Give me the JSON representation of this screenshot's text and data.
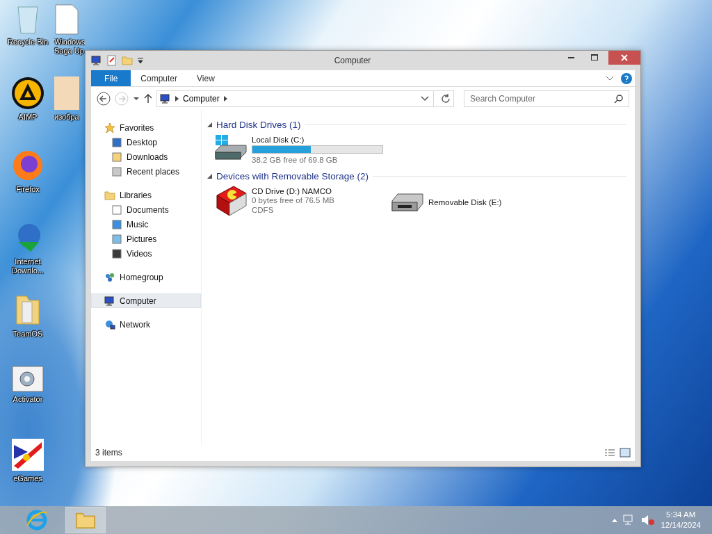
{
  "desktop_icons": [
    {
      "label": "Recycle Bin"
    },
    {
      "label": "AIMP"
    },
    {
      "label": "Firefox"
    },
    {
      "label": "Internet Downlo..."
    },
    {
      "label": "TeamOS"
    },
    {
      "label": "Activator"
    },
    {
      "label": "eGames"
    }
  ],
  "desktop_icons_column_2": [
    {
      "label": "Windows Saga Up"
    },
    {
      "label": "изобра"
    }
  ],
  "window": {
    "title": "Computer"
  },
  "ribbon_tabs": [
    {
      "label": "File",
      "selected": true
    },
    {
      "label": "Computer",
      "selected": false
    },
    {
      "label": "View",
      "selected": false
    }
  ],
  "address_bar": {
    "path": "Computer"
  },
  "search": {
    "placeholder": "Search Computer"
  },
  "navigation": [
    {
      "label": "Favorites",
      "selected": false,
      "children": [
        {
          "label": "Desktop"
        },
        {
          "label": "Downloads"
        },
        {
          "label": "Recent places"
        }
      ]
    },
    {
      "label": "Libraries",
      "selected": false,
      "children": [
        {
          "label": "Documents"
        },
        {
          "label": "Music"
        },
        {
          "label": "Pictures"
        },
        {
          "label": "Videos"
        }
      ]
    },
    {
      "label": "Homegroup",
      "selected": false
    },
    {
      "label": "Computer",
      "selected": true
    },
    {
      "label": "Network",
      "selected": false
    }
  ],
  "sections": [
    {
      "title": "Hard Disk Drives (1)",
      "items": [
        {
          "kind": "bar",
          "name": "Local Disk (C:)",
          "level": 0.45,
          "details": [
            "38.2 GB free of 69.8 GB"
          ]
        }
      ]
    },
    {
      "title": "Devices with Removable Storage (2)",
      "items": [
        {
          "kind": "optical",
          "name": "CD Drive (D:) NAMCO",
          "details": [
            "0 bytes free of 76.5 MB",
            "CDFS"
          ]
        },
        {
          "kind": "removable",
          "name": "Removable Disk (E:)"
        }
      ]
    }
  ],
  "status_bar": {
    "count": "3 items"
  },
  "taskbar": {
    "time": "5:34 AM",
    "date": "12/14/2024"
  }
}
